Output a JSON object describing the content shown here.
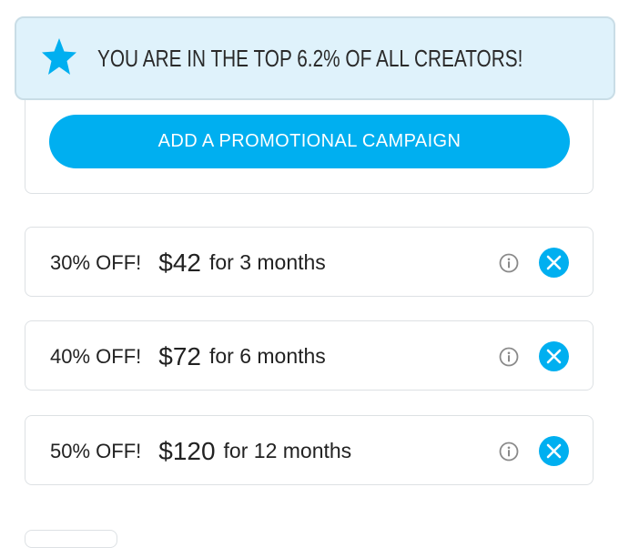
{
  "banner": {
    "text": "YOU ARE IN THE TOP 6.2% OF ALL CREATORS!",
    "icon": "star-icon"
  },
  "campaign": {
    "button_label": "ADD A PROMOTIONAL CAMPAIGN"
  },
  "offers": [
    {
      "discount": "30% OFF!",
      "price": "$42",
      "duration": "for 3 months"
    },
    {
      "discount": "40% OFF!",
      "price": "$72",
      "duration": "for 6 months"
    },
    {
      "discount": "50% OFF!",
      "price": "$120",
      "duration": "for 12 months"
    }
  ],
  "icons": {
    "info": "info-icon",
    "close": "close-icon"
  },
  "colors": {
    "accent": "#00aff0",
    "banner_background": "#dff2fb",
    "banner_border": "#c9dde6",
    "card_border": "#dde1e4",
    "text": "#222222",
    "info_icon": "#8a8a8a"
  }
}
